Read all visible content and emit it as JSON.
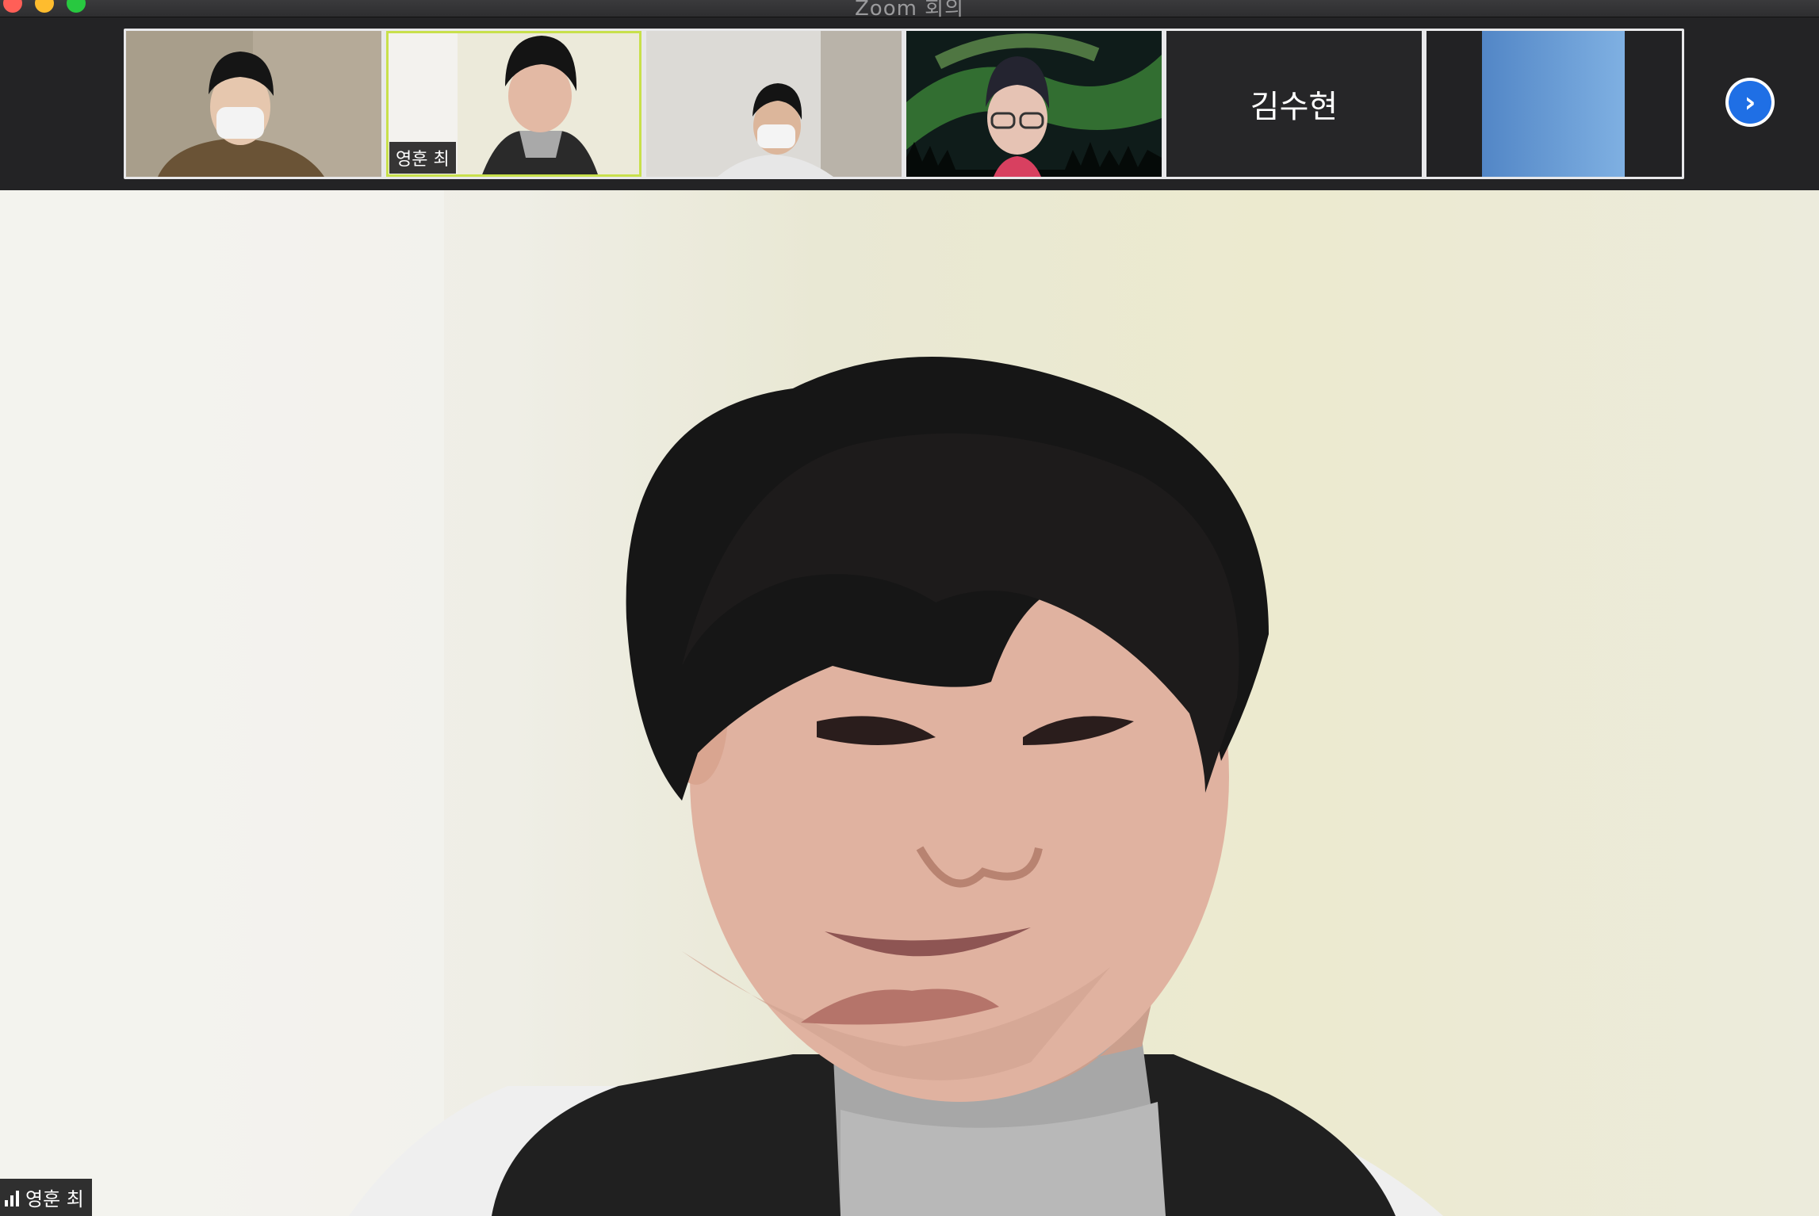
{
  "window": {
    "title": "Zoom 회의"
  },
  "thumbnails": [
    {
      "label": ""
    },
    {
      "label": "영훈 최"
    },
    {
      "label": ""
    },
    {
      "label": ""
    },
    {
      "label": "김수현"
    },
    {
      "label": ""
    }
  ],
  "main_video": {
    "speaker_label": "영훈 최"
  }
}
